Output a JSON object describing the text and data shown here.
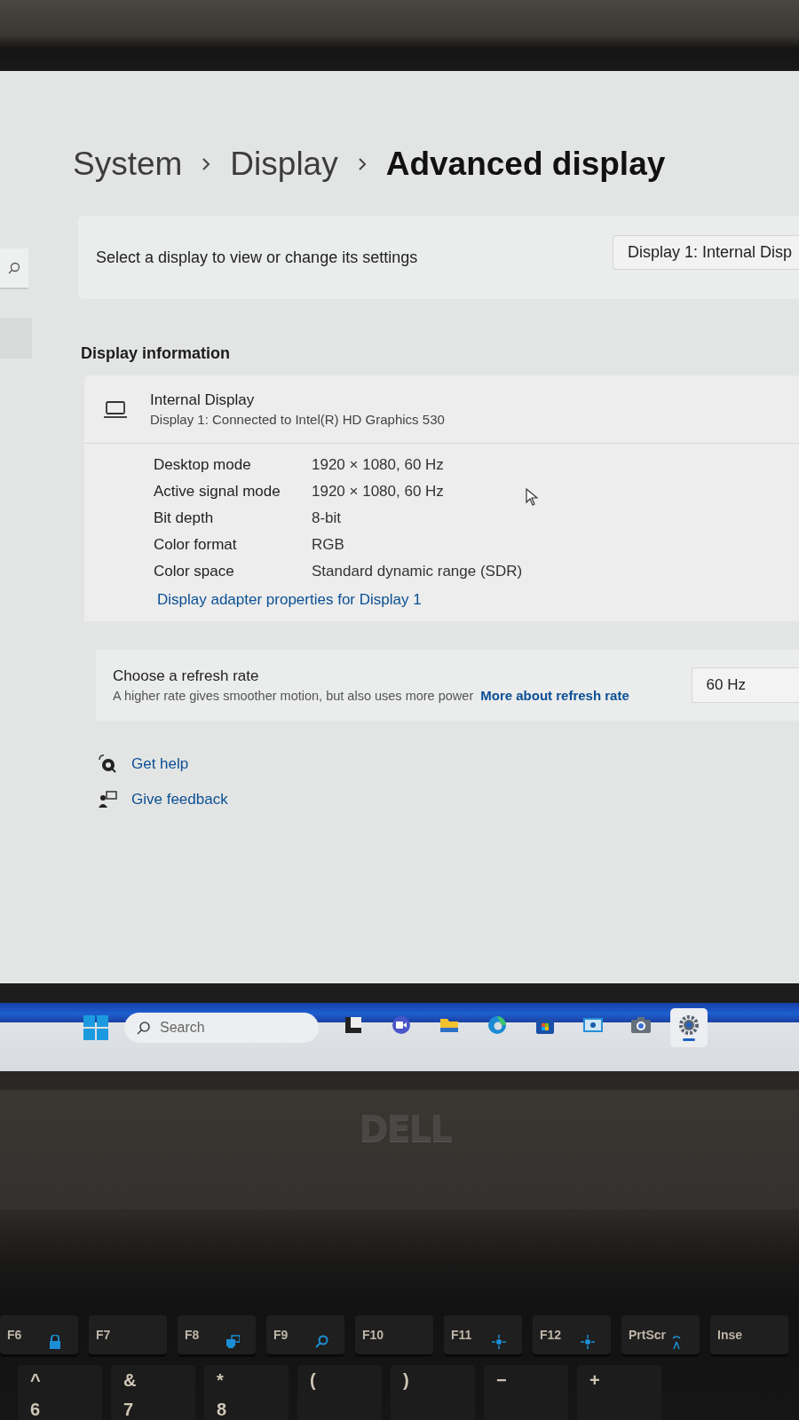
{
  "breadcrumb": [
    {
      "label": "System",
      "current": false
    },
    {
      "label": "Display",
      "current": false
    },
    {
      "label": "Advanced display",
      "current": true
    }
  ],
  "display_select": {
    "label": "Select a display to view or change its settings",
    "value": "Display 1: Internal Disp"
  },
  "section_title": "Display information",
  "display": {
    "name": "Internal Display",
    "description": "Display 1: Connected to Intel(R) HD Graphics 530"
  },
  "properties": [
    {
      "label": "Desktop mode",
      "value": "1920 × 1080, 60 Hz"
    },
    {
      "label": "Active signal mode",
      "value": "1920 × 1080, 60 Hz"
    },
    {
      "label": "Bit depth",
      "value": "8-bit"
    },
    {
      "label": "Color format",
      "value": "RGB"
    },
    {
      "label": "Color space",
      "value": "Standard dynamic range (SDR)"
    }
  ],
  "adapter_link": "Display adapter properties for Display 1",
  "refresh": {
    "title": "Choose a refresh rate",
    "description": "A higher rate gives smoother motion, but also uses more power",
    "link": "More about refresh rate",
    "value": "60 Hz"
  },
  "help_links": [
    {
      "kind": "help",
      "label": "Get help"
    },
    {
      "kind": "feedback",
      "label": "Give feedback"
    }
  ],
  "taskbar": {
    "search_placeholder": "Search",
    "apps": [
      {
        "kind": "task-view",
        "selected": false
      },
      {
        "kind": "chat",
        "selected": false
      },
      {
        "kind": "folder",
        "selected": false
      },
      {
        "kind": "browser",
        "selected": false
      },
      {
        "kind": "store",
        "selected": false
      },
      {
        "kind": "photos",
        "selected": false
      },
      {
        "kind": "camera",
        "selected": false
      },
      {
        "kind": "settings",
        "selected": true
      }
    ]
  },
  "bezel": {
    "logo": "DELL"
  },
  "keyboard": {
    "function_row": [
      {
        "label": "F6",
        "kind": "lock"
      },
      {
        "label": "F7",
        "kind": "plain"
      },
      {
        "label": "F8",
        "kind": "display"
      },
      {
        "label": "F9",
        "kind": "search"
      },
      {
        "label": "F10",
        "kind": "plain"
      },
      {
        "label": "F11",
        "kind": "brightness"
      },
      {
        "label": "F12",
        "kind": "brightness"
      },
      {
        "label": "PrtScr",
        "kind": "wireless"
      },
      {
        "label": "Inse",
        "kind": "plain"
      }
    ],
    "number_row": [
      {
        "upper": "^",
        "lower": "6"
      },
      {
        "upper": "&",
        "lower": "7"
      },
      {
        "upper": "*",
        "lower": "8"
      },
      {
        "upper": "("
      },
      {
        "upper": ")"
      },
      {
        "upper": "−"
      },
      {
        "upper": "+"
      }
    ]
  }
}
